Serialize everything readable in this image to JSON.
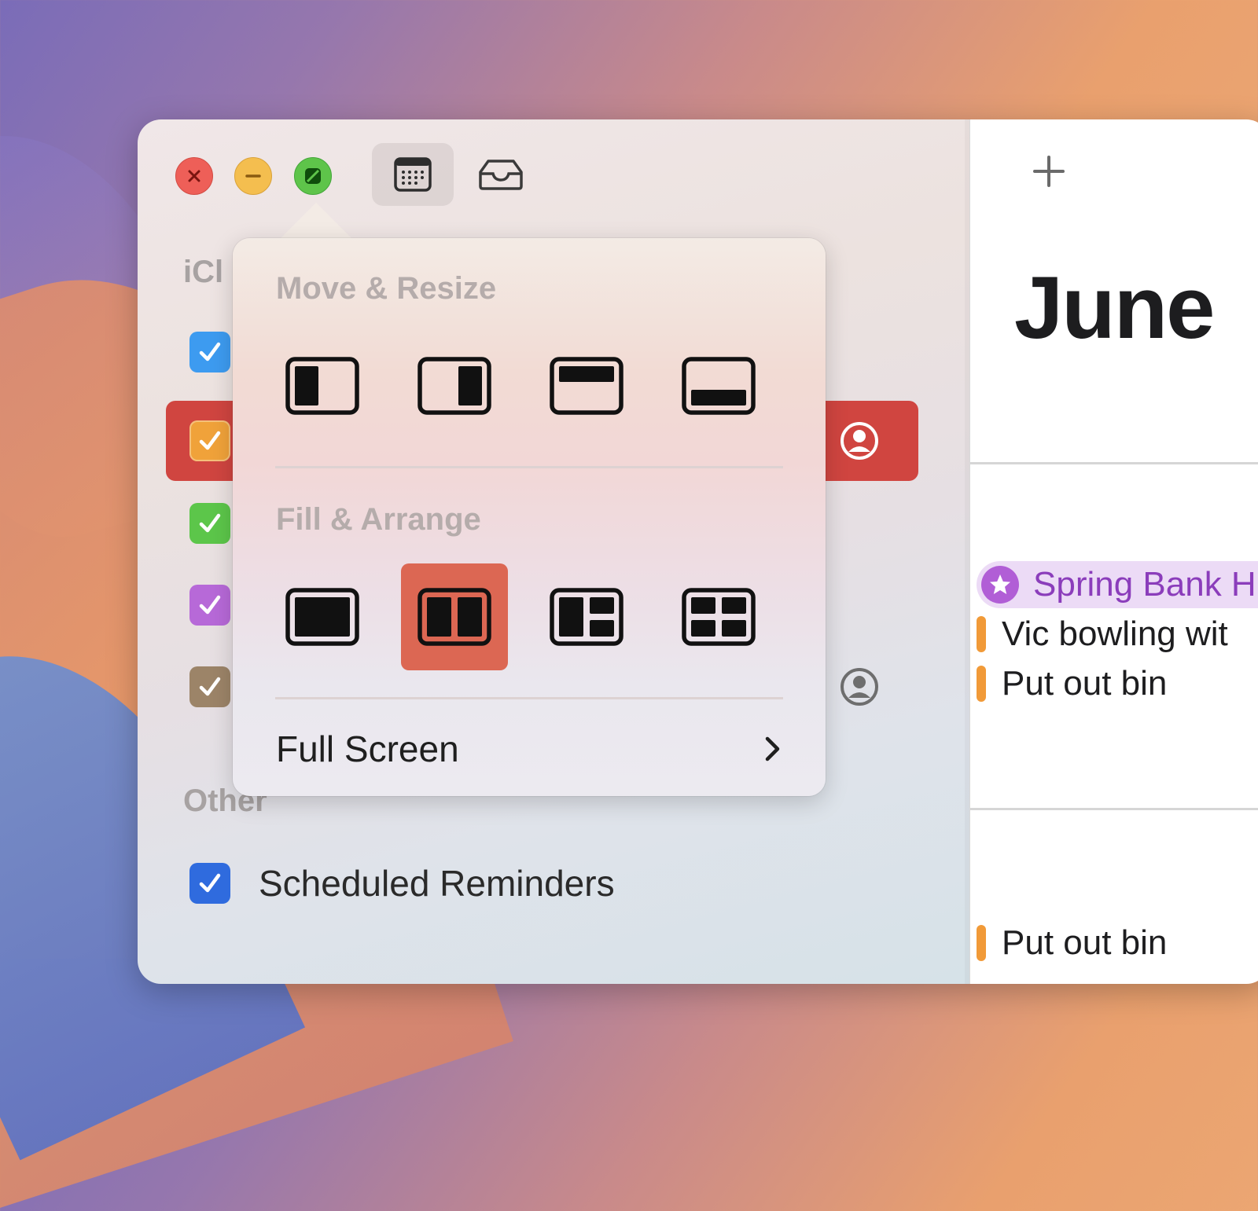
{
  "window": {
    "controls": [
      "close",
      "minimize",
      "zoom"
    ],
    "toolbar": [
      {
        "name": "calendar-view",
        "icon": "calendar-grid-icon"
      },
      {
        "name": "inbox",
        "icon": "inbox-tray-icon"
      }
    ]
  },
  "sidebar": {
    "sections": [
      {
        "title": "iCloud",
        "visible_text": "iCl"
      },
      {
        "title": "Other"
      }
    ],
    "calendars": [
      {
        "color": "#3d9bf0",
        "selected": false,
        "shared": false
      },
      {
        "color": "#f0a23a",
        "selected": true,
        "shared": true
      },
      {
        "color": "#5cc64a",
        "selected": false,
        "shared": false
      },
      {
        "color": "#b769d8",
        "selected": false,
        "shared": false
      },
      {
        "color": "#9c8468",
        "selected": false,
        "shared": true
      }
    ],
    "other": [
      {
        "label": "Scheduled Reminders",
        "color": "#2f6bde"
      }
    ],
    "accent": "#d04540"
  },
  "popover": {
    "move_resize_title": "Move & Resize",
    "fill_arrange_title": "Fill & Arrange",
    "move_resize": [
      {
        "name": "left-half",
        "icon": "tile-left-icon"
      },
      {
        "name": "right-half",
        "icon": "tile-right-icon"
      },
      {
        "name": "top-half",
        "icon": "tile-top-icon"
      },
      {
        "name": "bottom-half",
        "icon": "tile-bottom-icon"
      }
    ],
    "fill_arrange": [
      {
        "name": "fill",
        "icon": "fill-screen-icon",
        "selected": false
      },
      {
        "name": "left-and-right",
        "icon": "split-two-icon",
        "selected": true
      },
      {
        "name": "left-and-quarters",
        "icon": "split-three-icon",
        "selected": false
      },
      {
        "name": "quarters",
        "icon": "split-four-icon",
        "selected": false
      }
    ],
    "full_screen_label": "Full Screen",
    "selected_color": "#dc6753"
  },
  "main": {
    "month": "June",
    "events": [
      {
        "title": "Spring Bank H",
        "type": "holiday",
        "color": "#b15ed6"
      },
      {
        "title": "Vic bowling wit",
        "color": "#f19a38"
      },
      {
        "title": "Put out bin",
        "color": "#f19a38"
      },
      {
        "title": "Put out bin",
        "color": "#f19a38"
      }
    ]
  }
}
